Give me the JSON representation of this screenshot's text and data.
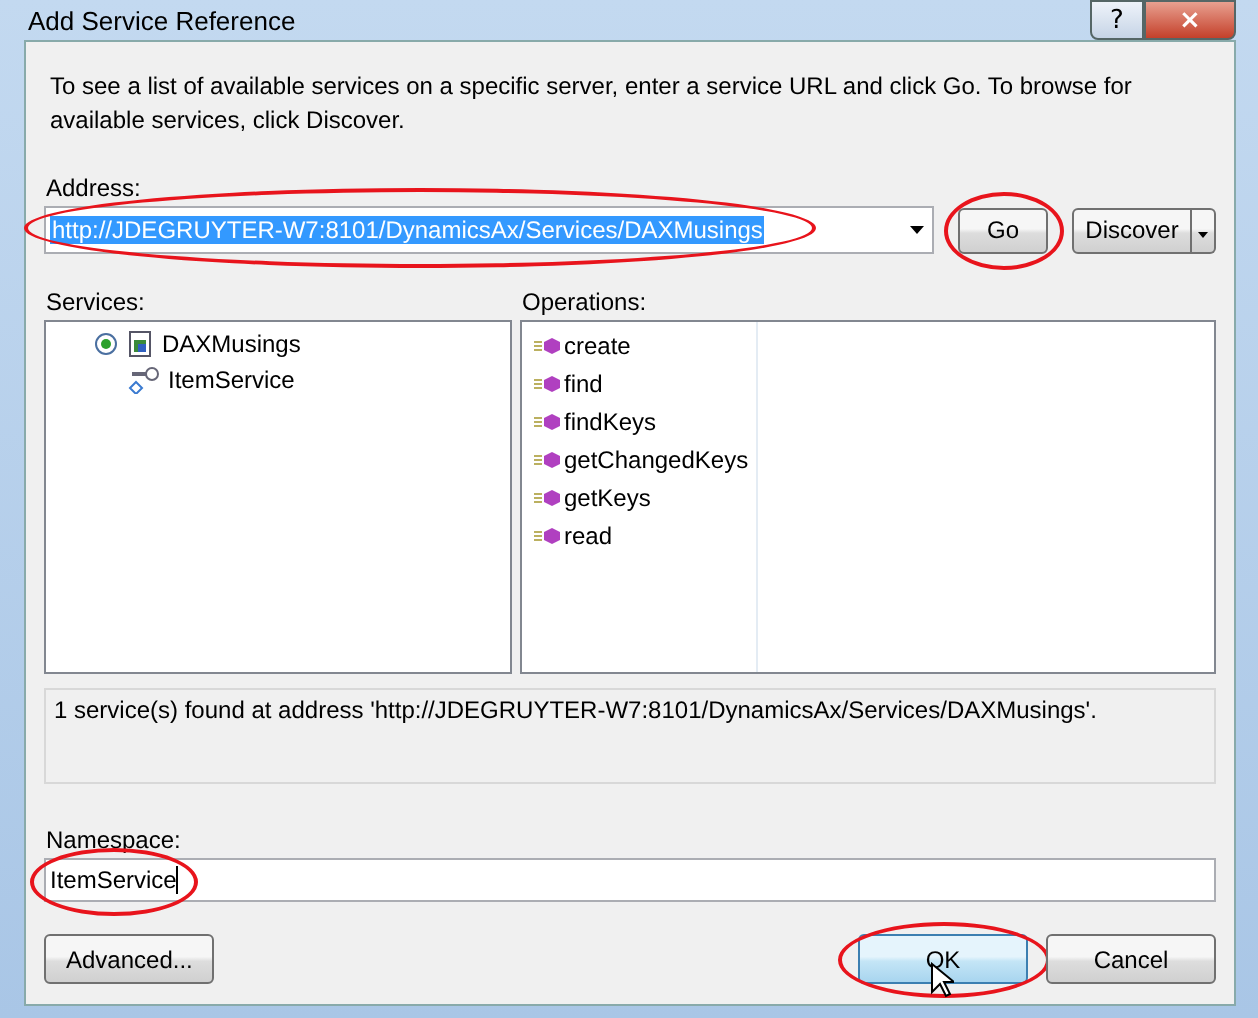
{
  "window": {
    "title": "Add Service Reference",
    "help": "?",
    "close": "×"
  },
  "description": "To see a list of available services on a specific server, enter a service URL and click Go. To browse for available services, click Discover.",
  "address": {
    "label": "Address:",
    "value": "http://JDEGRUYTER-W7:8101/DynamicsAx/Services/DAXMusings",
    "selected": true,
    "circled": true
  },
  "go_button": {
    "label": "Go",
    "circled": true
  },
  "discover_button": {
    "label": "Discover"
  },
  "services": {
    "label": "Services:",
    "items": [
      {
        "label": "DAXMusings",
        "expanded": true,
        "children": [
          {
            "label": "ItemService"
          }
        ]
      }
    ]
  },
  "operations": {
    "label": "Operations:",
    "items": [
      "create",
      "find",
      "findKeys",
      "getChangedKeys",
      "getKeys",
      "read"
    ]
  },
  "status": "1 service(s) found at address 'http://JDEGRUYTER-W7:8101/DynamicsAx/Services/DAXMusings'.",
  "namespace": {
    "label": "Namespace:",
    "value": "ItemService",
    "circled": true
  },
  "buttons": [
    {
      "label": "Advanced...",
      "kind": "left",
      "default": false,
      "circled": false
    },
    {
      "label": "OK",
      "kind": "right",
      "default": true,
      "circled": true
    },
    {
      "label": "Cancel",
      "kind": "right",
      "default": false,
      "circled": false
    }
  ]
}
